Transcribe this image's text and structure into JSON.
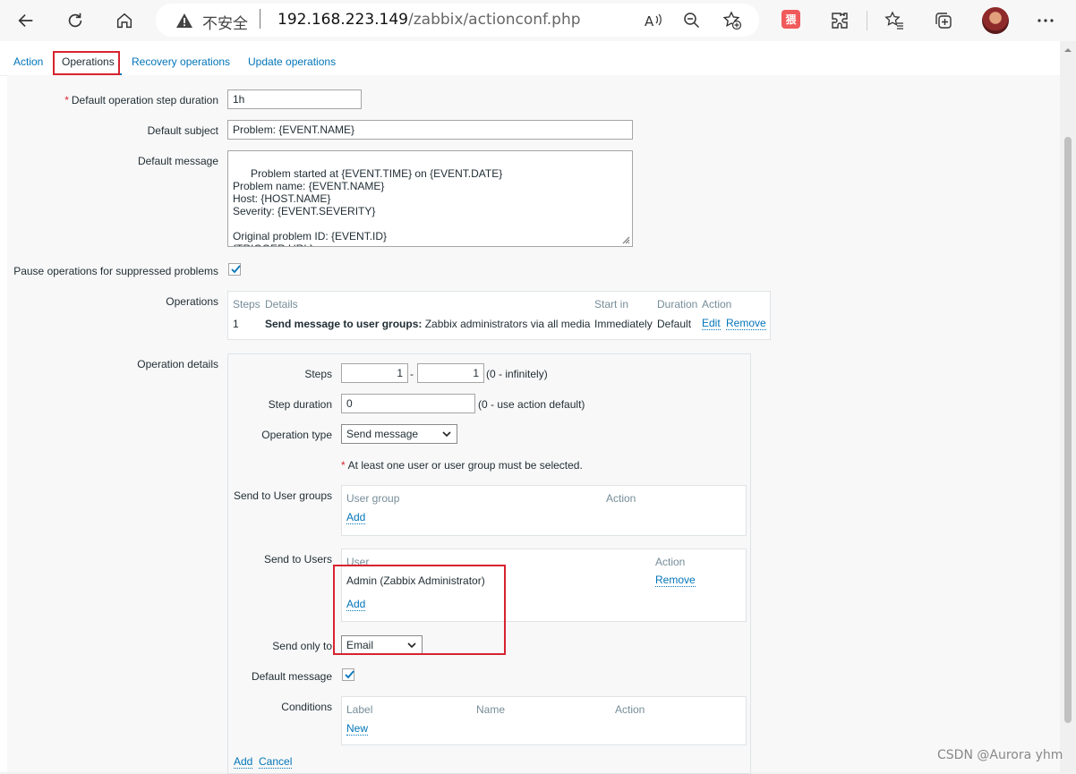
{
  "browser": {
    "insecure_label": "不安全",
    "url_host": "192.168.223.149",
    "url_path": "/zabbix/actionconf.php",
    "extension_badge": "猥"
  },
  "tabs": [
    "Action",
    "Operations",
    "Recovery operations",
    "Update operations"
  ],
  "active_tab": "Operations",
  "form": {
    "step_duration_label": "Default operation step duration",
    "step_duration_value": "1h",
    "subject_label": "Default subject",
    "subject_value": "Problem: {EVENT.NAME}",
    "message_label": "Default message",
    "message_value": "Problem started at {EVENT.TIME} on {EVENT.DATE}\nProblem name: {EVENT.NAME}\nHost: {HOST.NAME}\nSeverity: {EVENT.SEVERITY}\n\nOriginal problem ID: {EVENT.ID}\n{TRIGGER.URL}",
    "pause_label": "Pause operations for suppressed problems",
    "pause_checked": true,
    "operations_label": "Operations"
  },
  "operations_table": {
    "headers": [
      "Steps",
      "Details",
      "Start in",
      "Duration",
      "Action"
    ],
    "rows": [
      {
        "steps": "1",
        "details_bold": "Send message to user groups:",
        "details_rest": " Zabbix administrators via all media",
        "start_in": "Immediately",
        "duration": "Default",
        "edit": "Edit",
        "remove": "Remove"
      }
    ]
  },
  "op_details": {
    "label": "Operation details",
    "steps_label": "Steps",
    "steps_from": "1",
    "steps_sep": "-",
    "steps_to": "1",
    "steps_hint": "(0 - infinitely)",
    "duration_label": "Step duration",
    "duration_value": "0",
    "duration_hint": "(0 - use action default)",
    "type_label": "Operation type",
    "type_value": "Send message",
    "warning": "At least one user or user group must be selected.",
    "groups_label": "Send to User groups",
    "groups_headers": [
      "User group",
      "Action"
    ],
    "groups_add": "Add",
    "users_label": "Send to Users",
    "users_headers": [
      "User",
      "Action"
    ],
    "users_row": {
      "name": "Admin (Zabbix Administrator)",
      "remove": "Remove"
    },
    "users_add": "Add",
    "send_only_label": "Send only to",
    "send_only_value": "Email",
    "default_msg_label": "Default message",
    "default_msg_checked": true,
    "conditions_label": "Conditions",
    "conditions_headers": [
      "Label",
      "Name",
      "Action"
    ],
    "conditions_new": "New",
    "add": "Add",
    "cancel": "Cancel"
  },
  "watermark": "CSDN @Aurora yhm"
}
